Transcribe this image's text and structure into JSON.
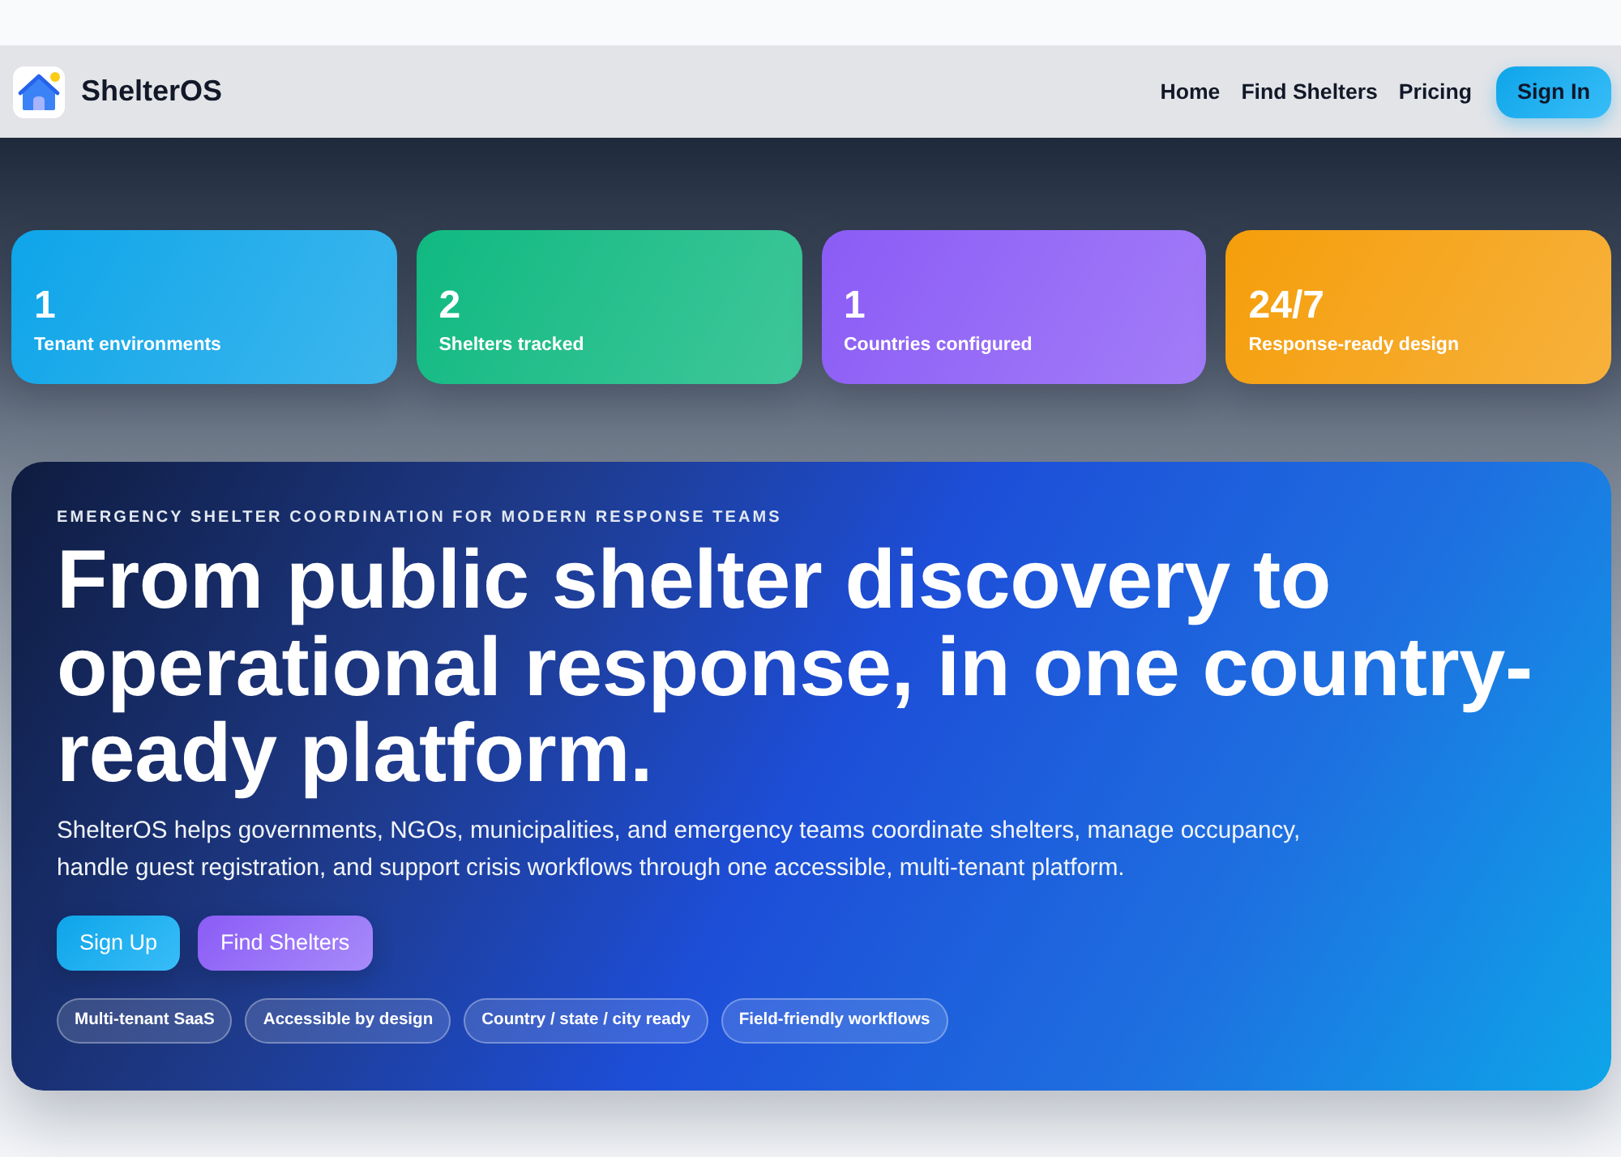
{
  "header": {
    "brand": "ShelterOS",
    "nav": [
      {
        "label": "Home"
      },
      {
        "label": "Find Shelters"
      },
      {
        "label": "Pricing"
      }
    ],
    "sign_in": "Sign In"
  },
  "stats": [
    {
      "value": "1",
      "label": "Tenant environments",
      "color": "#0ea5e9"
    },
    {
      "value": "2",
      "label": "Shelters tracked",
      "color": "#10b981"
    },
    {
      "value": "1",
      "label": "Countries configured",
      "color": "#8b5cf6"
    },
    {
      "value": "24/7",
      "label": "Response-ready design",
      "color": "#f59e0b"
    }
  ],
  "hero": {
    "eyebrow": "EMERGENCY SHELTER COORDINATION FOR MODERN RESPONSE TEAMS",
    "title": "From public shelter discovery to operational response, in one country-ready platform.",
    "description": "ShelterOS helps governments, NGOs, municipalities, and emergency teams coordinate shelters, manage occupancy, handle guest registration, and support crisis workflows through one accessible, multi-tenant platform.",
    "buttons": [
      {
        "label": "Sign Up",
        "kind": "primary"
      },
      {
        "label": "Find Shelters",
        "kind": "secondary"
      }
    ],
    "tags": [
      {
        "label": "Multi-tenant SaaS"
      },
      {
        "label": "Accessible by design"
      },
      {
        "label": "Country / state / city ready"
      },
      {
        "label": "Field-friendly workflows"
      }
    ]
  }
}
